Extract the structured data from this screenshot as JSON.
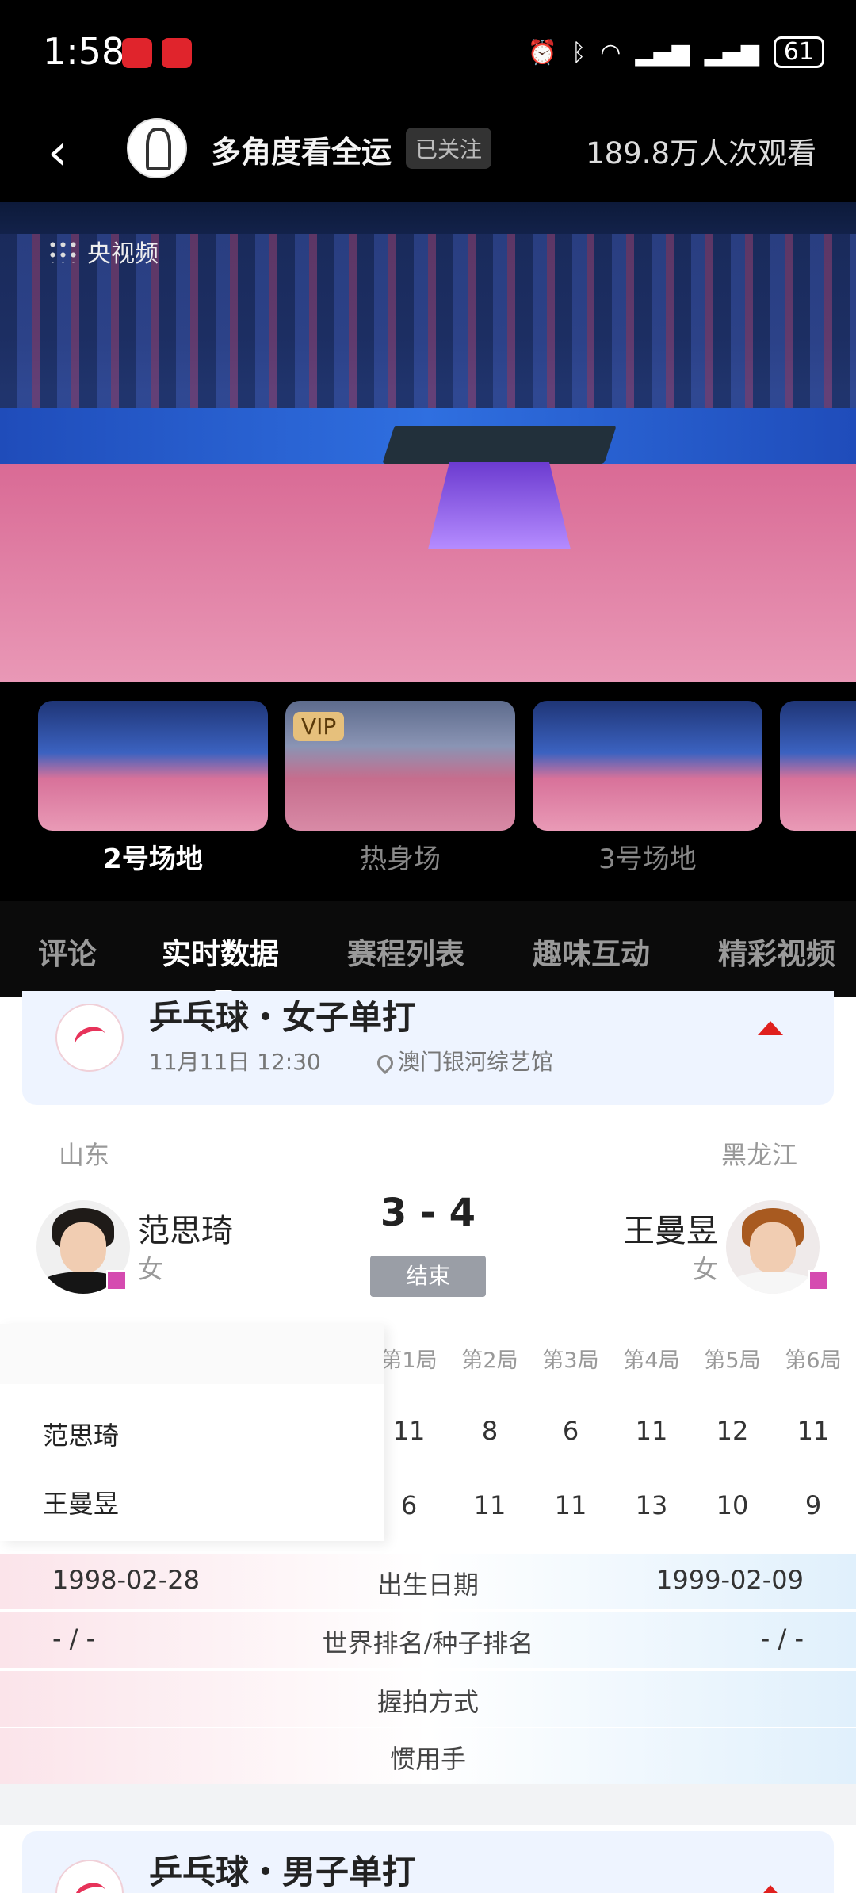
{
  "status_bar": {
    "time": "1:58",
    "battery": "61"
  },
  "header": {
    "back_glyph": "‹",
    "title": "多角度看全运",
    "follow_label": "已关注",
    "views": "189.8万人次观看"
  },
  "video": {
    "watermark": "央视频"
  },
  "angles": [
    {
      "label": "2号场地",
      "vip": ""
    },
    {
      "label": "热身场",
      "vip": "VIP"
    },
    {
      "label": "3号场地",
      "vip": ""
    }
  ],
  "tabs": [
    "评论",
    "实时数据",
    "赛程列表",
    "趣味互动",
    "精彩视频"
  ],
  "match": {
    "event": "乒乓球・女子单打",
    "time": "11月11日 12:30",
    "venue": "澳门银河综艺馆",
    "left": {
      "province": "山东",
      "name": "范思琦",
      "gender": "女"
    },
    "right": {
      "province": "黑龙江",
      "name": "王曼昱",
      "gender": "女"
    },
    "score": "3 - 4",
    "status": "结束"
  },
  "sets": {
    "headers": [
      "第1局",
      "第2局",
      "第3局",
      "第4局",
      "第5局",
      "第6局"
    ],
    "rows": [
      {
        "name": "范思琦",
        "scores": [
          "11",
          "8",
          "6",
          "11",
          "12",
          "11"
        ]
      },
      {
        "name": "王曼昱",
        "scores": [
          "6",
          "11",
          "11",
          "13",
          "10",
          "9"
        ]
      }
    ]
  },
  "comparison": [
    {
      "label": "出生日期",
      "left": "1998-02-28",
      "right": "1999-02-09"
    },
    {
      "label": "世界排名/种子排名",
      "left": "- / -",
      "right": "- / -"
    },
    {
      "label": "握拍方式",
      "left": "",
      "right": ""
    },
    {
      "label": "惯用手",
      "left": "",
      "right": ""
    }
  ],
  "next_event": {
    "event": "乒乓球・男子单打"
  },
  "colors": {
    "accent_red": "#e0201e",
    "tag_pink": "#d54bb0"
  }
}
